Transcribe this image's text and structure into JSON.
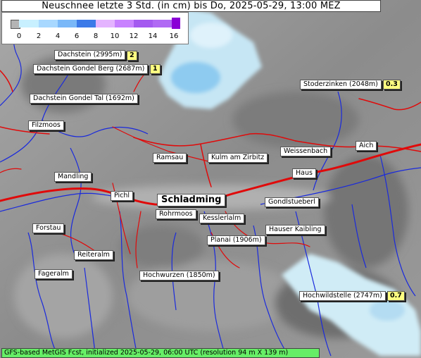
{
  "title": "Neuschnee letzte 3 Std. (in cm) bis Do, 2025-05-29, 13:00 MEZ",
  "legend": {
    "colors": [
      "#b4b4b4",
      "#c8f0ff",
      "#a8d8ff",
      "#7ab8f8",
      "#3c7ae8",
      "#e4b4ff",
      "#c882ff",
      "#a45af0",
      "#8a00d6"
    ],
    "ticks": [
      "0",
      "2",
      "4",
      "6",
      "8",
      "10",
      "12",
      "14",
      "16"
    ]
  },
  "places": [
    {
      "name": "Dachstein (2995m)",
      "value": "2"
    },
    {
      "name": "Dachstein Gondel Berg (2687m)",
      "value": "1"
    },
    {
      "name": "Dachstein Gondel Tal (1692m)"
    },
    {
      "name": "Stoderzinken (2048m)",
      "value": "0.3"
    },
    {
      "name": "Filzmoos"
    },
    {
      "name": "Ramsau"
    },
    {
      "name": "Kulm am Zirbitz"
    },
    {
      "name": "Weissenbach"
    },
    {
      "name": "Aich"
    },
    {
      "name": "Mandling"
    },
    {
      "name": "Haus"
    },
    {
      "name": "Pichl"
    },
    {
      "name": "Schladming"
    },
    {
      "name": "Gondlstueberl"
    },
    {
      "name": "Rohrmoos"
    },
    {
      "name": "Kesslerlalm"
    },
    {
      "name": "Forstau"
    },
    {
      "name": "Hauser Kaibling"
    },
    {
      "name": "Planai (1906m)"
    },
    {
      "name": "Reiteralm"
    },
    {
      "name": "Fageralm"
    },
    {
      "name": "Hochwurzen (1850m)"
    },
    {
      "name": "Hochwildstelle (2747m)",
      "value": "0.7"
    }
  ],
  "footer": "GFS-based MetGIS Fcst, initialized 2025-05-29, 06:00 UTC  (resolution 94 m X 139 m)"
}
